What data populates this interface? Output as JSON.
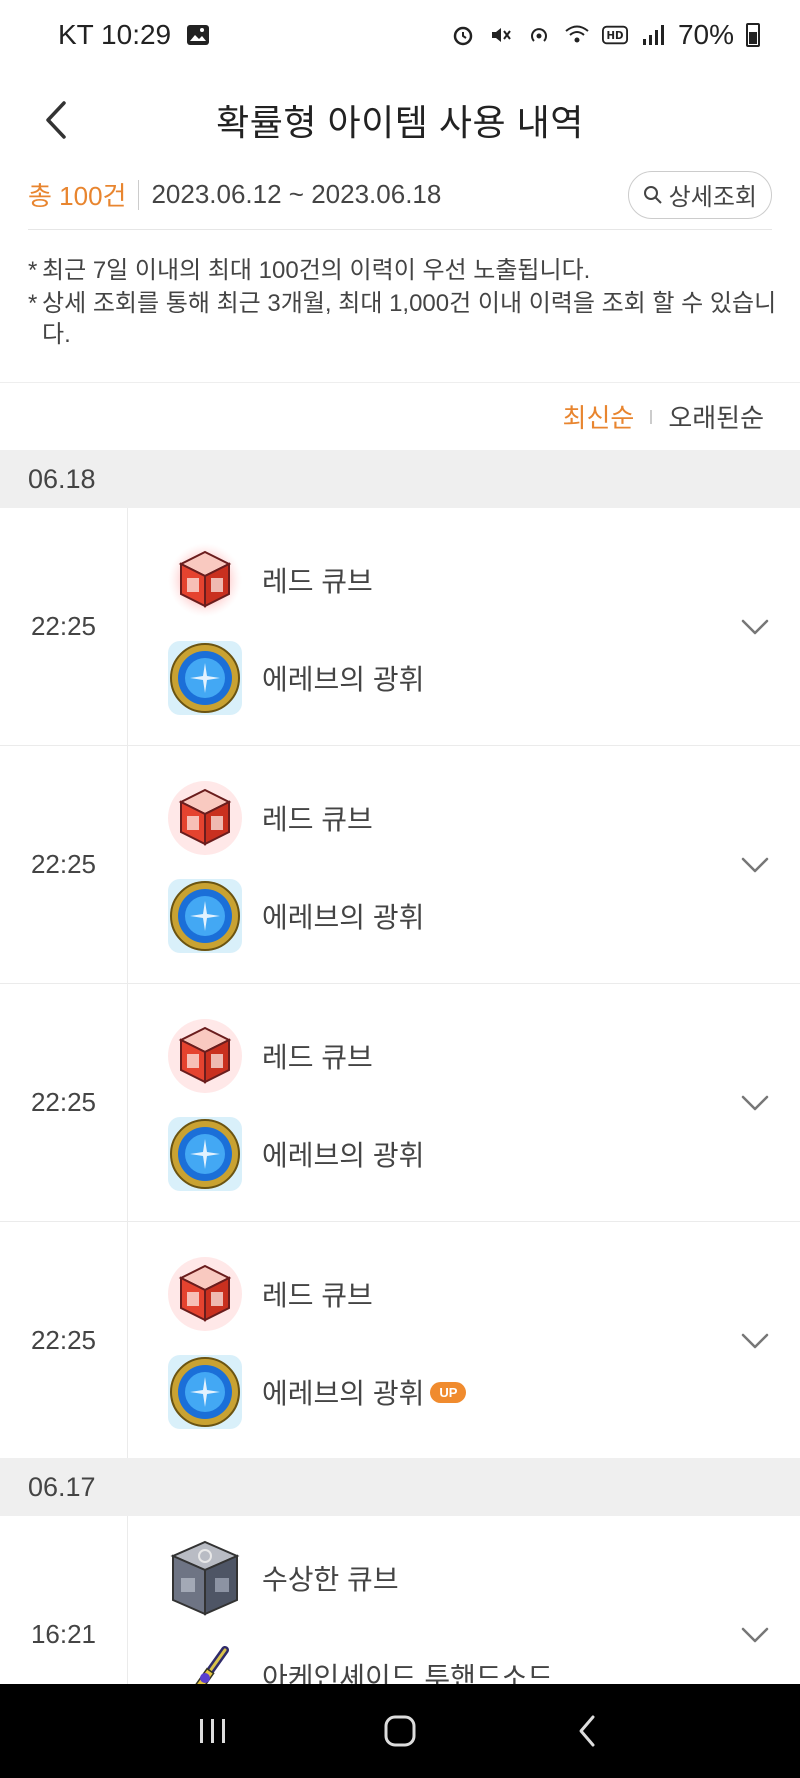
{
  "status_bar": {
    "carrier_time": "KT 10:29",
    "battery": "70%"
  },
  "header": {
    "title": "확률형 아이템 사용 내역"
  },
  "summary": {
    "total": "총 100건",
    "range": "2023.06.12 ~ 2023.06.18",
    "detail_button": "상세조회"
  },
  "notice": {
    "line1": "최근 7일 이내의 최대 100건의 이력이 우선 노출됩니다.",
    "line2": "상세 조회를 통해 최근 3개월, 최대 1,000건 이내 이력을 조회 할 수 있습니다."
  },
  "sort": {
    "newest": "최신순",
    "oldest": "오래된순"
  },
  "groups": [
    {
      "date": "06.18",
      "entries": [
        {
          "time": "22:25",
          "item1": "레드 큐브",
          "item2": "에레브의 광휘"
        },
        {
          "time": "22:25",
          "item1": "레드 큐브",
          "item2": "에레브의 광휘"
        },
        {
          "time": "22:25",
          "item1": "레드 큐브",
          "item2": "에레브의 광휘"
        },
        {
          "time": "22:25",
          "item1": "레드 큐브",
          "item2": "에레브의 광휘",
          "badge": "UP"
        }
      ]
    },
    {
      "date": "06.17",
      "entries": [
        {
          "time": "16:21",
          "item1": "수상한 큐브",
          "item2": "아케인셰이드 투핸드소드"
        }
      ]
    }
  ],
  "colors": {
    "accent": "#e8852f",
    "badge": "#f08b2e",
    "date_bg": "#efefef"
  }
}
